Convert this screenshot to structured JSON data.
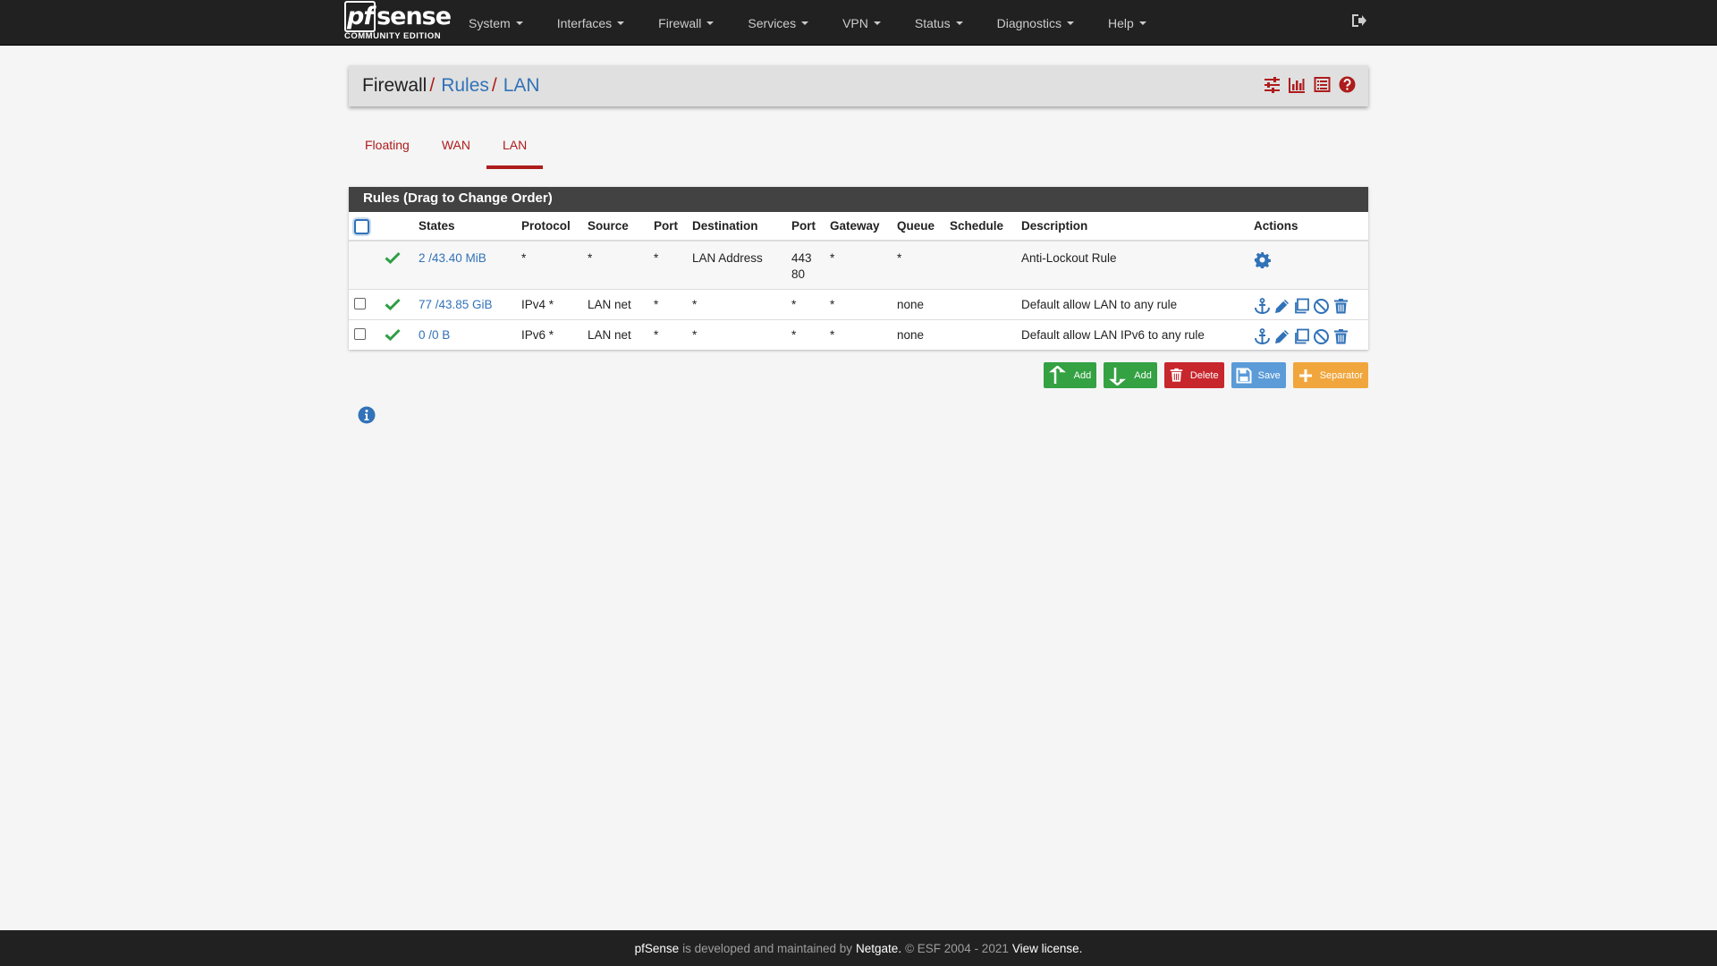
{
  "brand": {
    "logo_text": "sense",
    "logo_prefix": "pf",
    "edition": "COMMUNITY EDITION"
  },
  "nav": {
    "items": [
      {
        "label": "System"
      },
      {
        "label": "Interfaces"
      },
      {
        "label": "Firewall"
      },
      {
        "label": "Services"
      },
      {
        "label": "VPN"
      },
      {
        "label": "Status"
      },
      {
        "label": "Diagnostics"
      },
      {
        "label": "Help"
      }
    ],
    "logout_icon": "sign-out-icon"
  },
  "breadcrumb": {
    "firewall": "Firewall",
    "rules": "Rules",
    "lan": "LAN",
    "separator": "/"
  },
  "tabs": [
    {
      "label": "Floating"
    },
    {
      "label": "WAN"
    },
    {
      "label": "LAN"
    }
  ],
  "panel": {
    "title": "Rules (Drag to Change Order)"
  },
  "table": {
    "headers": [
      "States",
      "Protocol",
      "Source",
      "Port",
      "Destination",
      "Port",
      "Gateway",
      "Queue",
      "Schedule",
      "Description",
      "Actions"
    ],
    "rows": [
      {
        "states": "2 /43.40 MiB",
        "protocol": "*",
        "source": "*",
        "sport": "*",
        "destination": "LAN Address",
        "dport_1": "443",
        "dport_2": "80",
        "gateway": "*",
        "queue": "*",
        "schedule": "",
        "description": "Anti-Lockout Rule"
      },
      {
        "states": "77 /43.85 GiB",
        "protocol": "IPv4 *",
        "source": "LAN net",
        "sport": "*",
        "destination": "*",
        "dport": "*",
        "gateway": "*",
        "queue": "none",
        "schedule": "",
        "description": "Default allow LAN to any rule"
      },
      {
        "states": "0 /0 B",
        "protocol": "IPv6 *",
        "source": "LAN net",
        "sport": "*",
        "destination": "*",
        "dport": "*",
        "gateway": "*",
        "queue": "none",
        "schedule": "",
        "description": "Default allow LAN IPv6 to any rule"
      }
    ]
  },
  "buttons": {
    "add_top": "Add",
    "add_bottom": "Add",
    "delete": "Delete",
    "save": "Save",
    "separator": "Separator"
  },
  "footer": {
    "brand": "pfSense",
    "text1": "is developed and maintained by",
    "company": "Netgate.",
    "copyright": "© ESF 2004 - 2021",
    "license": "View license."
  },
  "colors": {
    "accent_red": "#ae1c1c",
    "link_blue": "#3172b8",
    "pass_green": "#2f9e44",
    "navbar": "#212121"
  }
}
